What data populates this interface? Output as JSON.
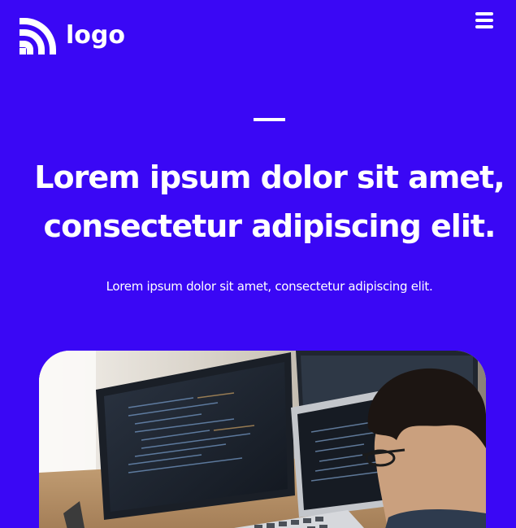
{
  "header": {
    "logo_text": "logo",
    "logo_icon": "signal-waves-icon",
    "menu_icon": "hamburger-menu-icon"
  },
  "hero": {
    "headline_line1": "Lorem ipsum dolor sit amet,",
    "headline_line2": "consectetur adipiscing elit.",
    "subtext": "Lorem ipsum dolor sit amet, consectetur adipiscing elit."
  },
  "image": {
    "subject": "developer-at-computer-photo"
  },
  "colors": {
    "background": "#3a07f5",
    "text": "#ffffff"
  }
}
